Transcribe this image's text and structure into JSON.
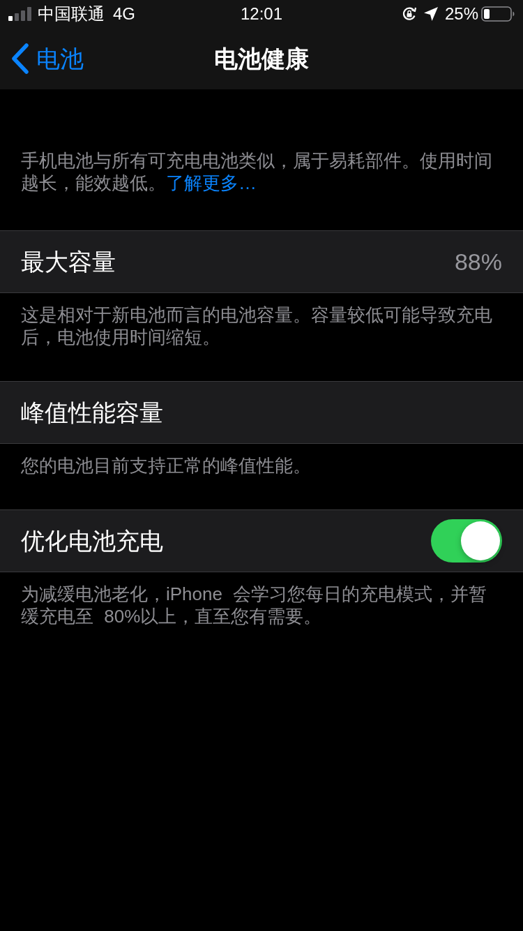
{
  "status_bar": {
    "carrier": "中国联通",
    "network": "4G",
    "time": "12:01",
    "battery": "25%"
  },
  "nav": {
    "back": "电池",
    "title": "电池健康"
  },
  "intro": {
    "text": "手机电池与所有可充电电池类似，属于易耗部件。使用时间越长，能效越低。",
    "link": "了解更多…"
  },
  "sections": [
    {
      "kind": "value",
      "label": "最大容量",
      "value": "88%",
      "footer": "这是相对于新电池而言的电池容量。容量较低可能导致充电后，电池使用时间缩短。"
    },
    {
      "kind": "plain",
      "label": "峰值性能容量",
      "footer": "您的电池目前支持正常的峰值性能。"
    },
    {
      "kind": "toggle",
      "label": "优化电池充电",
      "on": true,
      "footer": "为减缓电池老化，iPhone 会学习您每日的充电模式，并暂缓充电至 80%以上，直至您有需要。"
    }
  ]
}
